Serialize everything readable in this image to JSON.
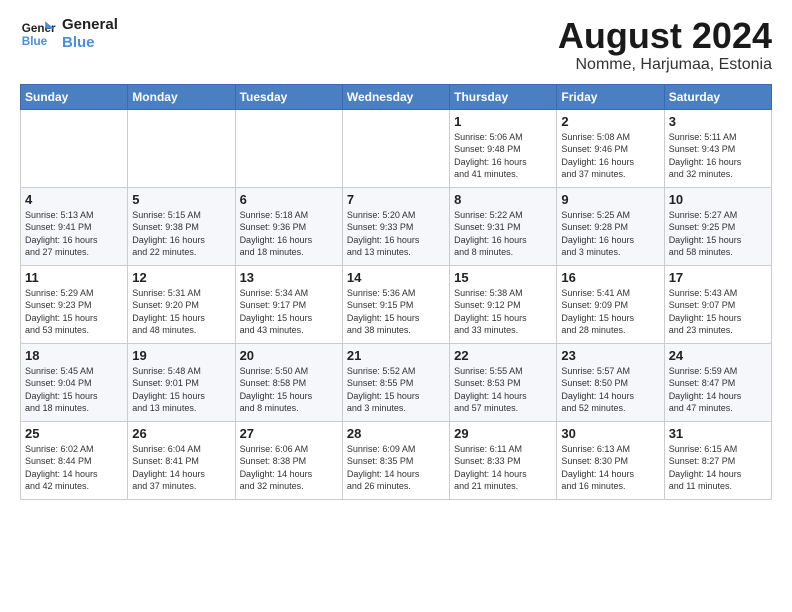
{
  "logo": {
    "line1": "General",
    "line2": "Blue"
  },
  "title": "August 2024",
  "subtitle": "Nomme, Harjumaa, Estonia",
  "weekdays": [
    "Sunday",
    "Monday",
    "Tuesday",
    "Wednesday",
    "Thursday",
    "Friday",
    "Saturday"
  ],
  "weeks": [
    [
      {
        "day": "",
        "text": ""
      },
      {
        "day": "",
        "text": ""
      },
      {
        "day": "",
        "text": ""
      },
      {
        "day": "",
        "text": ""
      },
      {
        "day": "1",
        "text": "Sunrise: 5:06 AM\nSunset: 9:48 PM\nDaylight: 16 hours\nand 41 minutes."
      },
      {
        "day": "2",
        "text": "Sunrise: 5:08 AM\nSunset: 9:46 PM\nDaylight: 16 hours\nand 37 minutes."
      },
      {
        "day": "3",
        "text": "Sunrise: 5:11 AM\nSunset: 9:43 PM\nDaylight: 16 hours\nand 32 minutes."
      }
    ],
    [
      {
        "day": "4",
        "text": "Sunrise: 5:13 AM\nSunset: 9:41 PM\nDaylight: 16 hours\nand 27 minutes."
      },
      {
        "day": "5",
        "text": "Sunrise: 5:15 AM\nSunset: 9:38 PM\nDaylight: 16 hours\nand 22 minutes."
      },
      {
        "day": "6",
        "text": "Sunrise: 5:18 AM\nSunset: 9:36 PM\nDaylight: 16 hours\nand 18 minutes."
      },
      {
        "day": "7",
        "text": "Sunrise: 5:20 AM\nSunset: 9:33 PM\nDaylight: 16 hours\nand 13 minutes."
      },
      {
        "day": "8",
        "text": "Sunrise: 5:22 AM\nSunset: 9:31 PM\nDaylight: 16 hours\nand 8 minutes."
      },
      {
        "day": "9",
        "text": "Sunrise: 5:25 AM\nSunset: 9:28 PM\nDaylight: 16 hours\nand 3 minutes."
      },
      {
        "day": "10",
        "text": "Sunrise: 5:27 AM\nSunset: 9:25 PM\nDaylight: 15 hours\nand 58 minutes."
      }
    ],
    [
      {
        "day": "11",
        "text": "Sunrise: 5:29 AM\nSunset: 9:23 PM\nDaylight: 15 hours\nand 53 minutes."
      },
      {
        "day": "12",
        "text": "Sunrise: 5:31 AM\nSunset: 9:20 PM\nDaylight: 15 hours\nand 48 minutes."
      },
      {
        "day": "13",
        "text": "Sunrise: 5:34 AM\nSunset: 9:17 PM\nDaylight: 15 hours\nand 43 minutes."
      },
      {
        "day": "14",
        "text": "Sunrise: 5:36 AM\nSunset: 9:15 PM\nDaylight: 15 hours\nand 38 minutes."
      },
      {
        "day": "15",
        "text": "Sunrise: 5:38 AM\nSunset: 9:12 PM\nDaylight: 15 hours\nand 33 minutes."
      },
      {
        "day": "16",
        "text": "Sunrise: 5:41 AM\nSunset: 9:09 PM\nDaylight: 15 hours\nand 28 minutes."
      },
      {
        "day": "17",
        "text": "Sunrise: 5:43 AM\nSunset: 9:07 PM\nDaylight: 15 hours\nand 23 minutes."
      }
    ],
    [
      {
        "day": "18",
        "text": "Sunrise: 5:45 AM\nSunset: 9:04 PM\nDaylight: 15 hours\nand 18 minutes."
      },
      {
        "day": "19",
        "text": "Sunrise: 5:48 AM\nSunset: 9:01 PM\nDaylight: 15 hours\nand 13 minutes."
      },
      {
        "day": "20",
        "text": "Sunrise: 5:50 AM\nSunset: 8:58 PM\nDaylight: 15 hours\nand 8 minutes."
      },
      {
        "day": "21",
        "text": "Sunrise: 5:52 AM\nSunset: 8:55 PM\nDaylight: 15 hours\nand 3 minutes."
      },
      {
        "day": "22",
        "text": "Sunrise: 5:55 AM\nSunset: 8:53 PM\nDaylight: 14 hours\nand 57 minutes."
      },
      {
        "day": "23",
        "text": "Sunrise: 5:57 AM\nSunset: 8:50 PM\nDaylight: 14 hours\nand 52 minutes."
      },
      {
        "day": "24",
        "text": "Sunrise: 5:59 AM\nSunset: 8:47 PM\nDaylight: 14 hours\nand 47 minutes."
      }
    ],
    [
      {
        "day": "25",
        "text": "Sunrise: 6:02 AM\nSunset: 8:44 PM\nDaylight: 14 hours\nand 42 minutes."
      },
      {
        "day": "26",
        "text": "Sunrise: 6:04 AM\nSunset: 8:41 PM\nDaylight: 14 hours\nand 37 minutes."
      },
      {
        "day": "27",
        "text": "Sunrise: 6:06 AM\nSunset: 8:38 PM\nDaylight: 14 hours\nand 32 minutes."
      },
      {
        "day": "28",
        "text": "Sunrise: 6:09 AM\nSunset: 8:35 PM\nDaylight: 14 hours\nand 26 minutes."
      },
      {
        "day": "29",
        "text": "Sunrise: 6:11 AM\nSunset: 8:33 PM\nDaylight: 14 hours\nand 21 minutes."
      },
      {
        "day": "30",
        "text": "Sunrise: 6:13 AM\nSunset: 8:30 PM\nDaylight: 14 hours\nand 16 minutes."
      },
      {
        "day": "31",
        "text": "Sunrise: 6:15 AM\nSunset: 8:27 PM\nDaylight: 14 hours\nand 11 minutes."
      }
    ]
  ]
}
